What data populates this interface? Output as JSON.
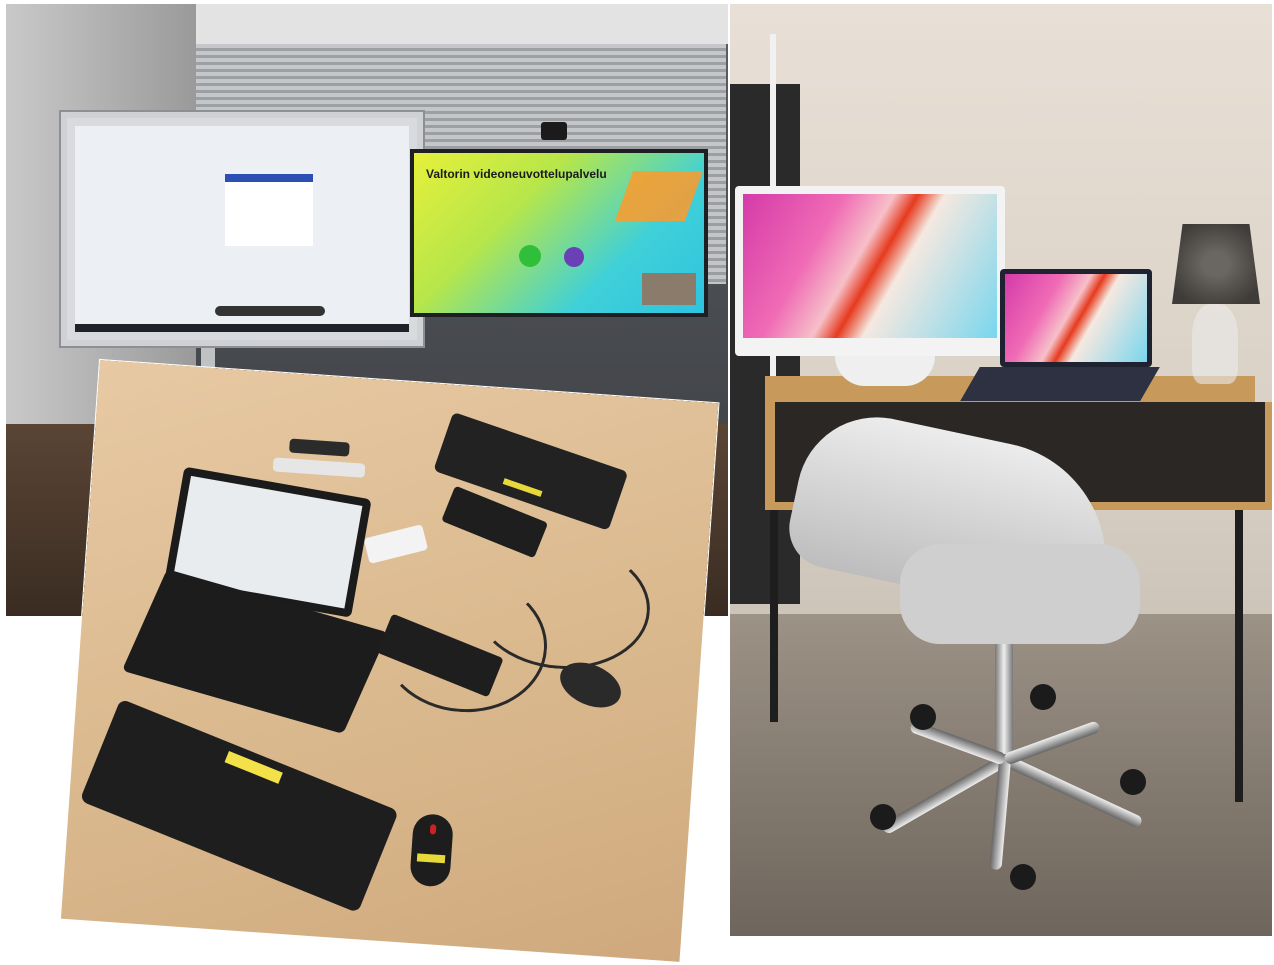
{
  "figure": {
    "left_photo": {
      "screen_title": "Valtorin videoneuvottelupalvelu"
    },
    "right_photo": {}
  }
}
